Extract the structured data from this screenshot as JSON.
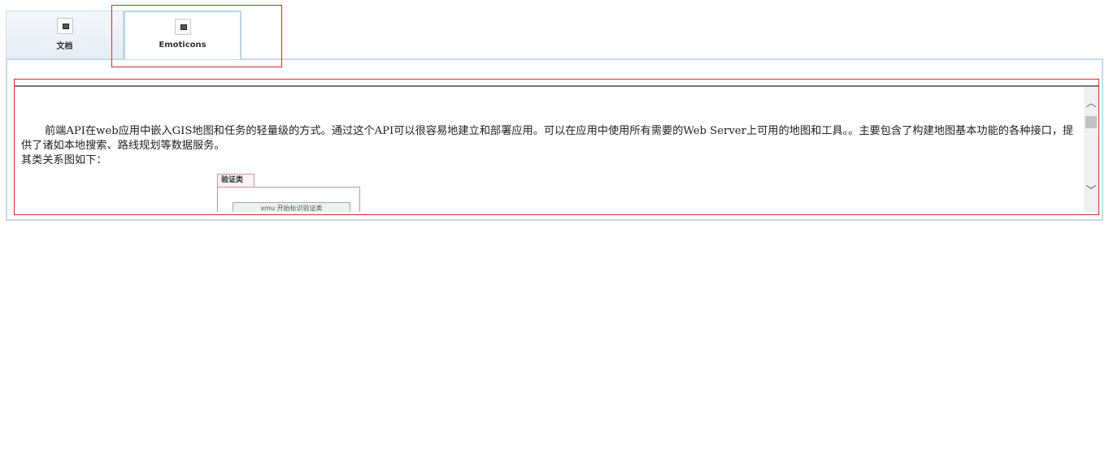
{
  "tabs": [
    {
      "label": "文档",
      "icon": "document-icon",
      "selected": false
    },
    {
      "label": "Emoticons",
      "icon": "emoticons-icon",
      "selected": true
    }
  ],
  "content": {
    "paragraph1": "前端API在web应用中嵌入GIS地图和任务的轻量级的方式。通过这个API可以很容易地建立和部署应用。可以在应用中使用所有需要的Web Server上可用的地图和工具。。主要包含了构建地图基本功能的各种接口，提供了诸如本地搜索、路线规划等数据服务。",
    "paragraph2": "其类关系图如下：",
    "diagram": {
      "tab_label": "验证类",
      "box_label": "xmu 开始标识验证类"
    }
  },
  "scrollbar": {
    "up_glyph": "︿",
    "down_glyph": "﹀"
  },
  "colors": {
    "highlight": "#d42a2a",
    "panel_border": "#c6dde8"
  }
}
